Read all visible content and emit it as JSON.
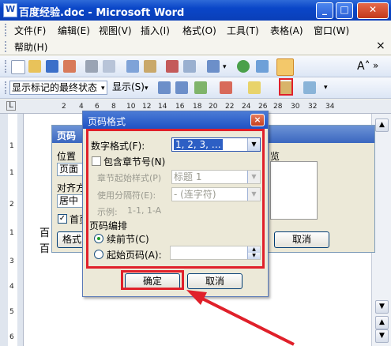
{
  "window": {
    "title": "百度经验.doc - Microsoft Word",
    "controls": {
      "minimize": "_",
      "maximize": "□",
      "close": "✕"
    }
  },
  "menubar": {
    "items": [
      "文件(F)",
      "编辑(E)",
      "视图(V)",
      "插入(I)",
      "格式(O)",
      "工具(T)",
      "表格(A)",
      "窗口(W)"
    ],
    "help": "帮助(H)",
    "close_doc": "×"
  },
  "toolbar2": {
    "display_mode": "显示标记的最终状态",
    "show_label": "显示(S)"
  },
  "ruler": {
    "ticks": [
      "2",
      "4",
      "6",
      "8",
      "10",
      "12",
      "14",
      "16",
      "18",
      "20",
      "22",
      "24",
      "26",
      "28",
      "30",
      "32",
      "34"
    ],
    "v_ticks": [
      "1",
      "1",
      "2",
      "1",
      "3",
      "4",
      "5",
      "6"
    ]
  },
  "back_dialog": {
    "title": "页码",
    "position_label": "位置",
    "position_value": "页面底",
    "align_label": "对齐方",
    "align_value": "居中",
    "first_page_label": "首页",
    "preview_label": "览",
    "format_button": "格式",
    "cancel_button": "取消"
  },
  "doc_text": {
    "line1": "百",
    "line2": "百"
  },
  "format_dialog": {
    "title": "页码格式",
    "close": "×",
    "number_format_label": "数字格式(F):",
    "number_format_value": "1, 2, 3, …",
    "include_chapter_label": "包含章节号(N)",
    "chapter_style_label": "章节起始样式(P)",
    "chapter_style_value": "标题 1",
    "separator_label": "使用分隔符(E):",
    "separator_value": "-  (连字符)",
    "example_label": "示例:",
    "example_value": "1-1, 1-A",
    "numbering_label": "页码编排",
    "continue_label": "续前节(C)",
    "start_at_label": "起始页码(A):",
    "ok_button": "确定",
    "cancel_button": "取消"
  },
  "colors": {
    "highlight_red": "#e0202a",
    "title_blue": "#0a46c8"
  }
}
